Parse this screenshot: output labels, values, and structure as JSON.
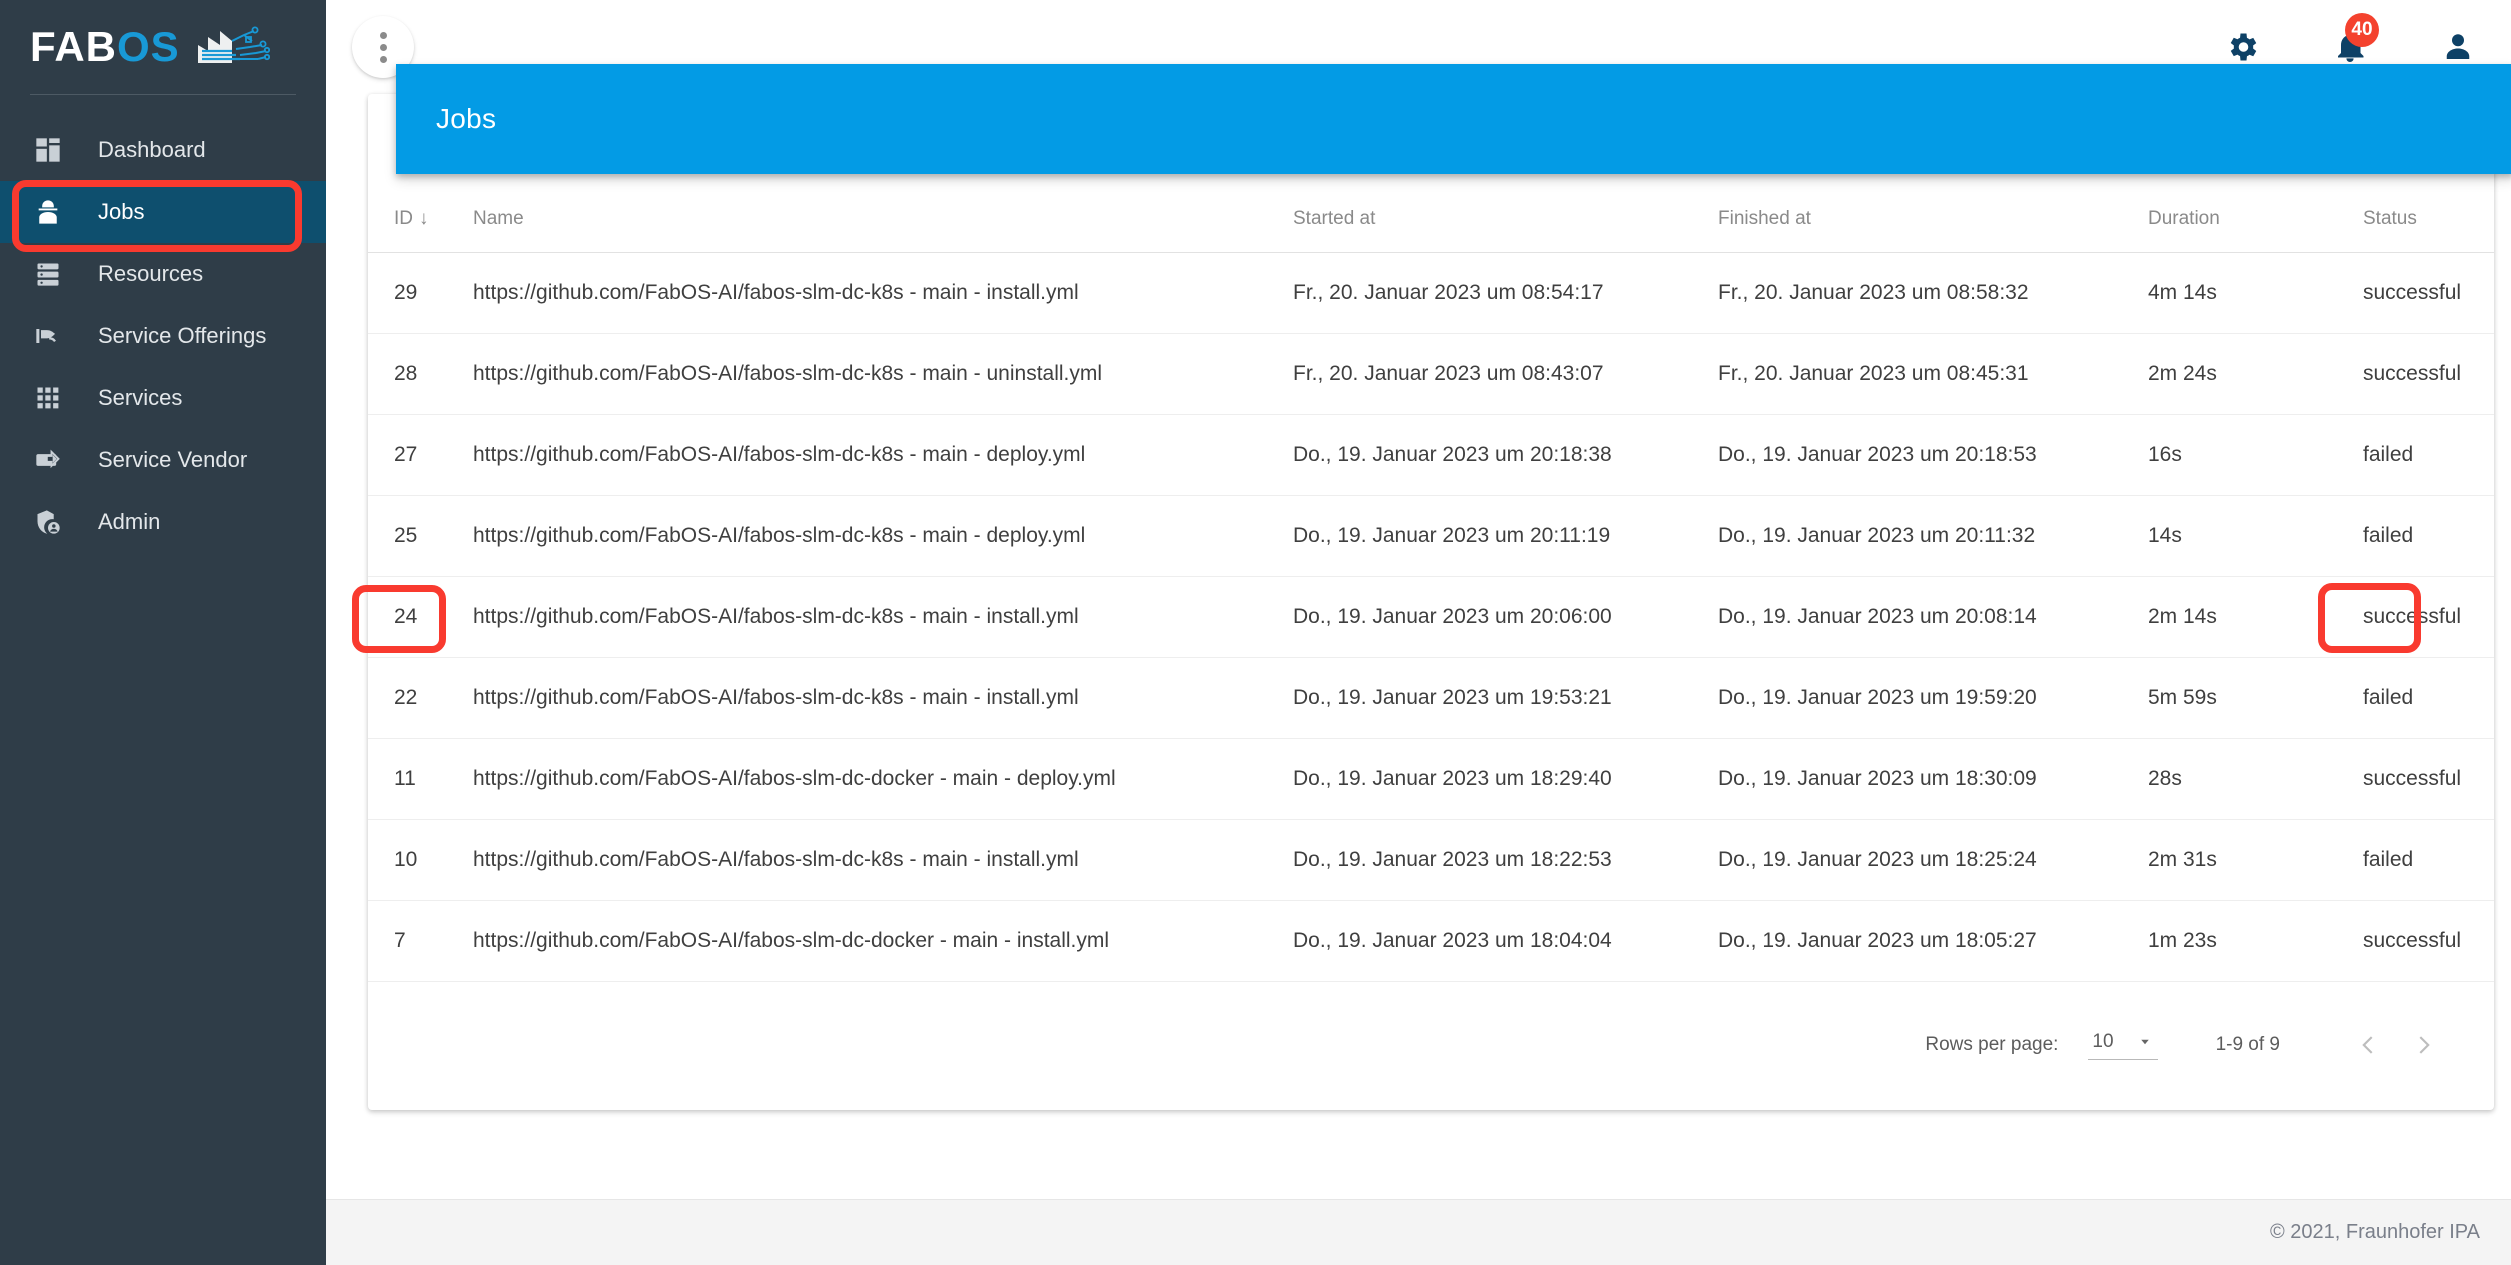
{
  "brand": {
    "logo_fab": "FAB",
    "logo_os": "OS",
    "logo_icon": "factory-circuit-icon"
  },
  "sidebar": {
    "items": [
      {
        "label": "Dashboard",
        "icon": "dashboard-icon",
        "active": false
      },
      {
        "label": "Jobs",
        "icon": "worker-icon",
        "active": true
      },
      {
        "label": "Resources",
        "icon": "server-rack-icon",
        "active": false
      },
      {
        "label": "Service Offerings",
        "icon": "flag-hand-icon",
        "active": false
      },
      {
        "label": "Services",
        "icon": "grid-dots-icon",
        "active": false
      },
      {
        "label": "Service Vendor",
        "icon": "vendor-arrow-icon",
        "active": false
      },
      {
        "label": "Admin",
        "icon": "shield-user-icon",
        "active": false
      }
    ]
  },
  "topbar": {
    "menu_icon": "more-vert-icon",
    "settings_icon": "gear-icon",
    "notifications_icon": "bell-icon",
    "notifications_count": "40",
    "account_icon": "person-icon"
  },
  "page": {
    "banner_title": "Jobs"
  },
  "table": {
    "columns": [
      "ID",
      "Name",
      "Started at",
      "Finished at",
      "Duration",
      "Status"
    ],
    "sort_column": "ID",
    "sort_direction_glyph": "↓",
    "rows": [
      {
        "id": "29",
        "name": "https://github.com/FabOS-AI/fabos-slm-dc-k8s - main - install.yml",
        "started": "Fr., 20. Januar 2023 um 08:54:17",
        "finished": "Fr., 20. Januar 2023 um 08:58:32",
        "duration": "4m 14s",
        "status": "successful"
      },
      {
        "id": "28",
        "name": "https://github.com/FabOS-AI/fabos-slm-dc-k8s - main - uninstall.yml",
        "started": "Fr., 20. Januar 2023 um 08:43:07",
        "finished": "Fr., 20. Januar 2023 um 08:45:31",
        "duration": "2m 24s",
        "status": "successful"
      },
      {
        "id": "27",
        "name": "https://github.com/FabOS-AI/fabos-slm-dc-k8s - main - deploy.yml",
        "started": "Do., 19. Januar 2023 um 20:18:38",
        "finished": "Do., 19. Januar 2023 um 20:18:53",
        "duration": "16s",
        "status": "failed"
      },
      {
        "id": "25",
        "name": "https://github.com/FabOS-AI/fabos-slm-dc-k8s - main - deploy.yml",
        "started": "Do., 19. Januar 2023 um 20:11:19",
        "finished": "Do., 19. Januar 2023 um 20:11:32",
        "duration": "14s",
        "status": "failed"
      },
      {
        "id": "24",
        "name": "https://github.com/FabOS-AI/fabos-slm-dc-k8s - main - install.yml",
        "started": "Do., 19. Januar 2023 um 20:06:00",
        "finished": "Do., 19. Januar 2023 um 20:08:14",
        "duration": "2m 14s",
        "status": "successful"
      },
      {
        "id": "22",
        "name": "https://github.com/FabOS-AI/fabos-slm-dc-k8s - main - install.yml",
        "started": "Do., 19. Januar 2023 um 19:53:21",
        "finished": "Do., 19. Januar 2023 um 19:59:20",
        "duration": "5m 59s",
        "status": "failed"
      },
      {
        "id": "11",
        "name": "https://github.com/FabOS-AI/fabos-slm-dc-docker - main - deploy.yml",
        "started": "Do., 19. Januar 2023 um 18:29:40",
        "finished": "Do., 19. Januar 2023 um 18:30:09",
        "duration": "28s",
        "status": "successful"
      },
      {
        "id": "10",
        "name": "https://github.com/FabOS-AI/fabos-slm-dc-k8s - main - install.yml",
        "started": "Do., 19. Januar 2023 um 18:22:53",
        "finished": "Do., 19. Januar 2023 um 18:25:24",
        "duration": "2m 31s",
        "status": "failed"
      },
      {
        "id": "7",
        "name": "https://github.com/FabOS-AI/fabos-slm-dc-docker - main - install.yml",
        "started": "Do., 19. Januar 2023 um 18:04:04",
        "finished": "Do., 19. Januar 2023 um 18:05:27",
        "duration": "1m 23s",
        "status": "successful"
      }
    ]
  },
  "paginator": {
    "rows_per_page_label": "Rows per page:",
    "rows_per_page_value": "10",
    "dropdown_icon": "chevron-down-icon",
    "range_label": "1-9 of 9",
    "prev_icon": "chevron-left-icon",
    "next_icon": "chevron-right-icon"
  },
  "footer": {
    "copyright": "© 2021, Fraunhofer IPA"
  },
  "colors": {
    "sidebar_bg": "#2f3d48",
    "sidebar_active_bg": "#0e4f6e",
    "banner_blue": "#039be5",
    "brand_blue": "#1899d6",
    "badge_red": "#f4422e",
    "annotation_red": "#f93a2f",
    "icon_navy": "#0e4166"
  },
  "annotations": [
    {
      "name": "jobs-nav-highlight",
      "target": "sidebar-item-jobs"
    },
    {
      "name": "job-22-id-highlight",
      "target": "row-22-id"
    },
    {
      "name": "job-22-status-highlight",
      "target": "row-22-status"
    }
  ]
}
